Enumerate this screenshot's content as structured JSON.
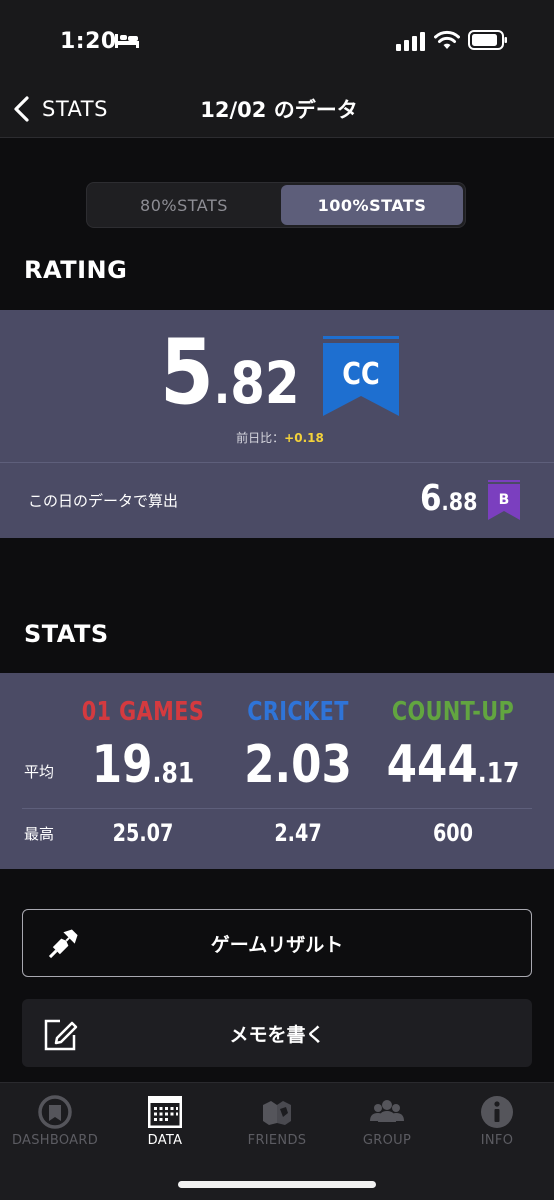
{
  "status_bar": {
    "time": "1:20"
  },
  "nav": {
    "back_label": "STATS",
    "title": "12/02 のデータ"
  },
  "segmented": {
    "option_80": "80%STATS",
    "option_100": "100%STATS",
    "selected": "100%STATS"
  },
  "rating": {
    "heading": "RATING",
    "value_int": "5",
    "value_dec": "82",
    "flag": "CC",
    "flag_color": "#1e6fd0",
    "prev_label": "前日比：",
    "prev_value": "+0.18",
    "day_calc_label": "この日のデータで算出",
    "day_value_int": "6",
    "day_value_dec": "88",
    "day_flag": "B",
    "day_flag_color": "#7b3fbf"
  },
  "stats": {
    "heading": "STATS",
    "avg_label": "平均",
    "max_label": "最高",
    "columns": [
      {
        "name": "01 GAMES",
        "color": "#d43a3f",
        "avg_int": "19",
        "avg_dec": "81",
        "max": "25.07"
      },
      {
        "name": "CRICKET",
        "color": "#2f74d8",
        "avg_int": "2",
        "avg_dec": "03",
        "max": "2.47"
      },
      {
        "name": "COUNT-UP",
        "color": "#62a540",
        "avg_int": "444",
        "avg_dec": "17",
        "max": "600"
      }
    ]
  },
  "buttons": {
    "game_results": "ゲームリザルト",
    "write_memo": "メモを書く"
  },
  "tabs": [
    {
      "label": "DASHBOARD",
      "icon": "dashboard-icon"
    },
    {
      "label": "DATA",
      "icon": "calendar-icon",
      "active": true
    },
    {
      "label": "FRIENDS",
      "icon": "friends-icon"
    },
    {
      "label": "GROUP",
      "icon": "group-icon"
    },
    {
      "label": "INFO",
      "icon": "info-icon"
    }
  ]
}
